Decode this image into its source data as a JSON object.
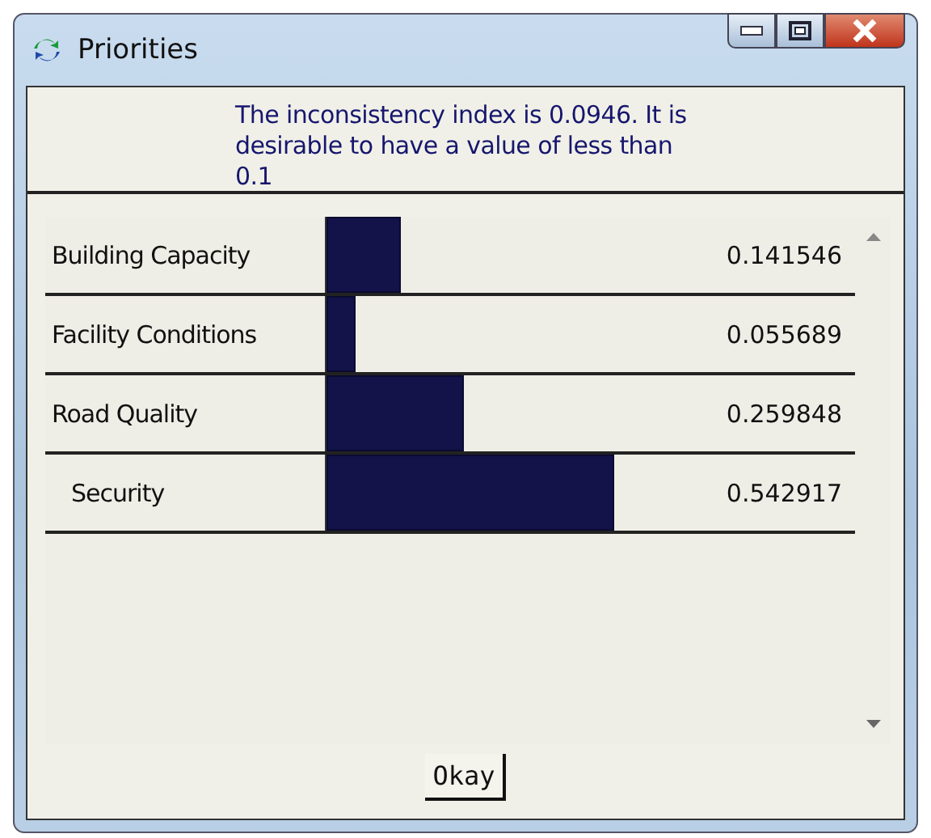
{
  "window": {
    "title": "Priorities"
  },
  "message": "The inconsistency index is 0.0946.  It is desirable to have a value of less than 0.1",
  "priorities": [
    {
      "name": "Building Capacity",
      "reading": "0.141546"
    },
    {
      "name": "Facility Conditions",
      "reading": "0.055689"
    },
    {
      "name": "Road Quality",
      "reading": "0.259848"
    },
    {
      "name": "Security",
      "reading": "0.542917"
    }
  ],
  "buttons": [
    "Okay"
  ]
}
